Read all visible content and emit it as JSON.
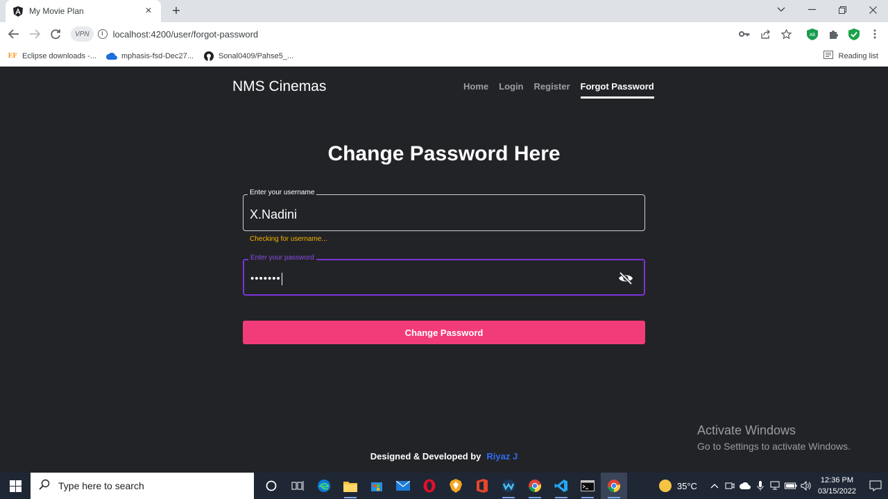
{
  "browser": {
    "tab_title": "My Movie Plan",
    "url": "localhost:4200/user/forgot-password",
    "vpn_label": "VPN",
    "bookmarks": [
      {
        "label": "Eclipse downloads -..."
      },
      {
        "label": "mphasis-fsd-Dec27..."
      },
      {
        "label": "Sonal0409/Pahse5_..."
      }
    ],
    "reading_list": "Reading list"
  },
  "site": {
    "brand": "NMS Cinemas",
    "nav": [
      {
        "label": "Home"
      },
      {
        "label": "Login"
      },
      {
        "label": "Register"
      },
      {
        "label": "Forgot Password",
        "active": true
      }
    ]
  },
  "form": {
    "heading": "Change Password Here",
    "username": {
      "label": "Enter your username",
      "value": "X.Nadini",
      "hint": "Checking for username..."
    },
    "password": {
      "label": "Enter your password",
      "value": "•••••••"
    },
    "submit_label": "Change Password"
  },
  "footer": {
    "text": "Designed & Developed by",
    "author": "Riyaz J"
  },
  "watermark": {
    "title": "Activate Windows",
    "subtitle": "Go to Settings to activate Windows."
  },
  "taskbar": {
    "search_placeholder": "Type here to search",
    "temperature": "35°C",
    "time": "12:36 PM",
    "date": "03/15/2022"
  },
  "colors": {
    "accent_button": "#f23c7a",
    "focus_border": "#7b33d9",
    "hint": "#f4b400",
    "author_link": "#2f6df0"
  }
}
